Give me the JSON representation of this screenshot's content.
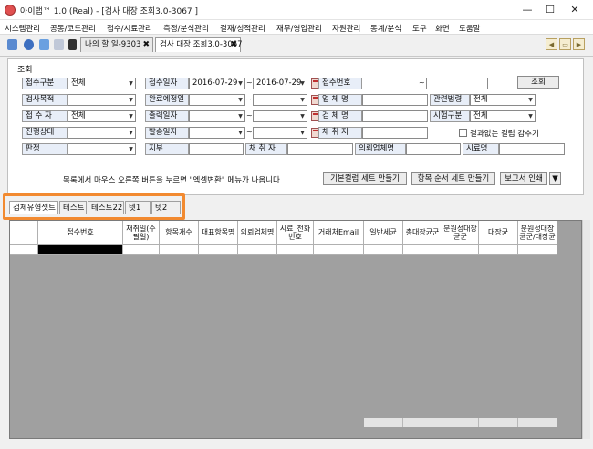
{
  "window": {
    "title": "아이랩™ 1.0 (Real) - [검사 대장 조회3.0-3067 ]",
    "minimize": "—",
    "maximize": "☐",
    "close": "✕"
  },
  "menu": [
    "시스템관리",
    "공통/코드관리",
    "접수/시료관리",
    "측정/분석관리",
    "결재/성적관리",
    "재무/영업관리",
    "자원관리",
    "통계/분석",
    "도구",
    "화면",
    "도움말"
  ],
  "doc_tabs": [
    "나의 할 일-9303",
    "검사 대장 조회3.0-3067"
  ],
  "search": {
    "section_title": "조회",
    "search_button": "조회",
    "rows": [
      {
        "label1": "접수구분",
        "value1": "전체",
        "label2": "접수일자",
        "date_from": "2016-07-29",
        "date_to": "2016-07-29",
        "label3": "접수번호",
        "value3": ""
      },
      {
        "label1": "검사목적",
        "value1": "",
        "label2": "완료예정일",
        "date_from": "",
        "date_to": "",
        "label3": "업 체 명",
        "value3": "",
        "label4": "관련법령",
        "value4": "전체"
      },
      {
        "label1": "접 수 자",
        "value1": "전체",
        "label2": "출력일자",
        "date_from": "",
        "date_to": "",
        "label3": "검 체 명",
        "value3": "",
        "label4": "시험구분",
        "value4": "전체"
      },
      {
        "label1": "진행상태",
        "value1": "",
        "label2": "발송일자",
        "date_from": "",
        "date_to": "",
        "label3": "채 취 지",
        "value3": "",
        "checkbox": "결과없는 컬럼 감추기"
      },
      {
        "label1": "판정",
        "value1": "",
        "label2": "지부",
        "value2": "",
        "label3": "채 취 자",
        "value3": "",
        "label4": "의뢰업체명",
        "value4": "",
        "label5": "시료명",
        "value5": ""
      }
    ],
    "hint": "목록에서 마우스 오른쪽 버튼을 누르면 \"엑셀변환\" 메뉴가 나옵니다",
    "buttons": [
      "기본컬럼 세트 만들기",
      "항목 순서 세트 만들기",
      "보고서 인쇄"
    ],
    "more": "▼"
  },
  "result_tabs": [
    "검체유형셋트",
    "테스트",
    "테스트22",
    "텟1",
    "텟2"
  ],
  "grid": {
    "columns": [
      "",
      "접수번호",
      "채취일(수필일)",
      "항목개수",
      "대표항목명",
      "의뢰업체명",
      "시료_전화번호",
      "거래처Email",
      "일반세균",
      "총대장균군",
      "분원성대장균군",
      "대장균",
      "분원성대장균군/대장균"
    ]
  },
  "colors": {
    "accent": "#f28a30",
    "label_bg": "#e8eef8",
    "grid_bg": "#a0a0a0"
  }
}
